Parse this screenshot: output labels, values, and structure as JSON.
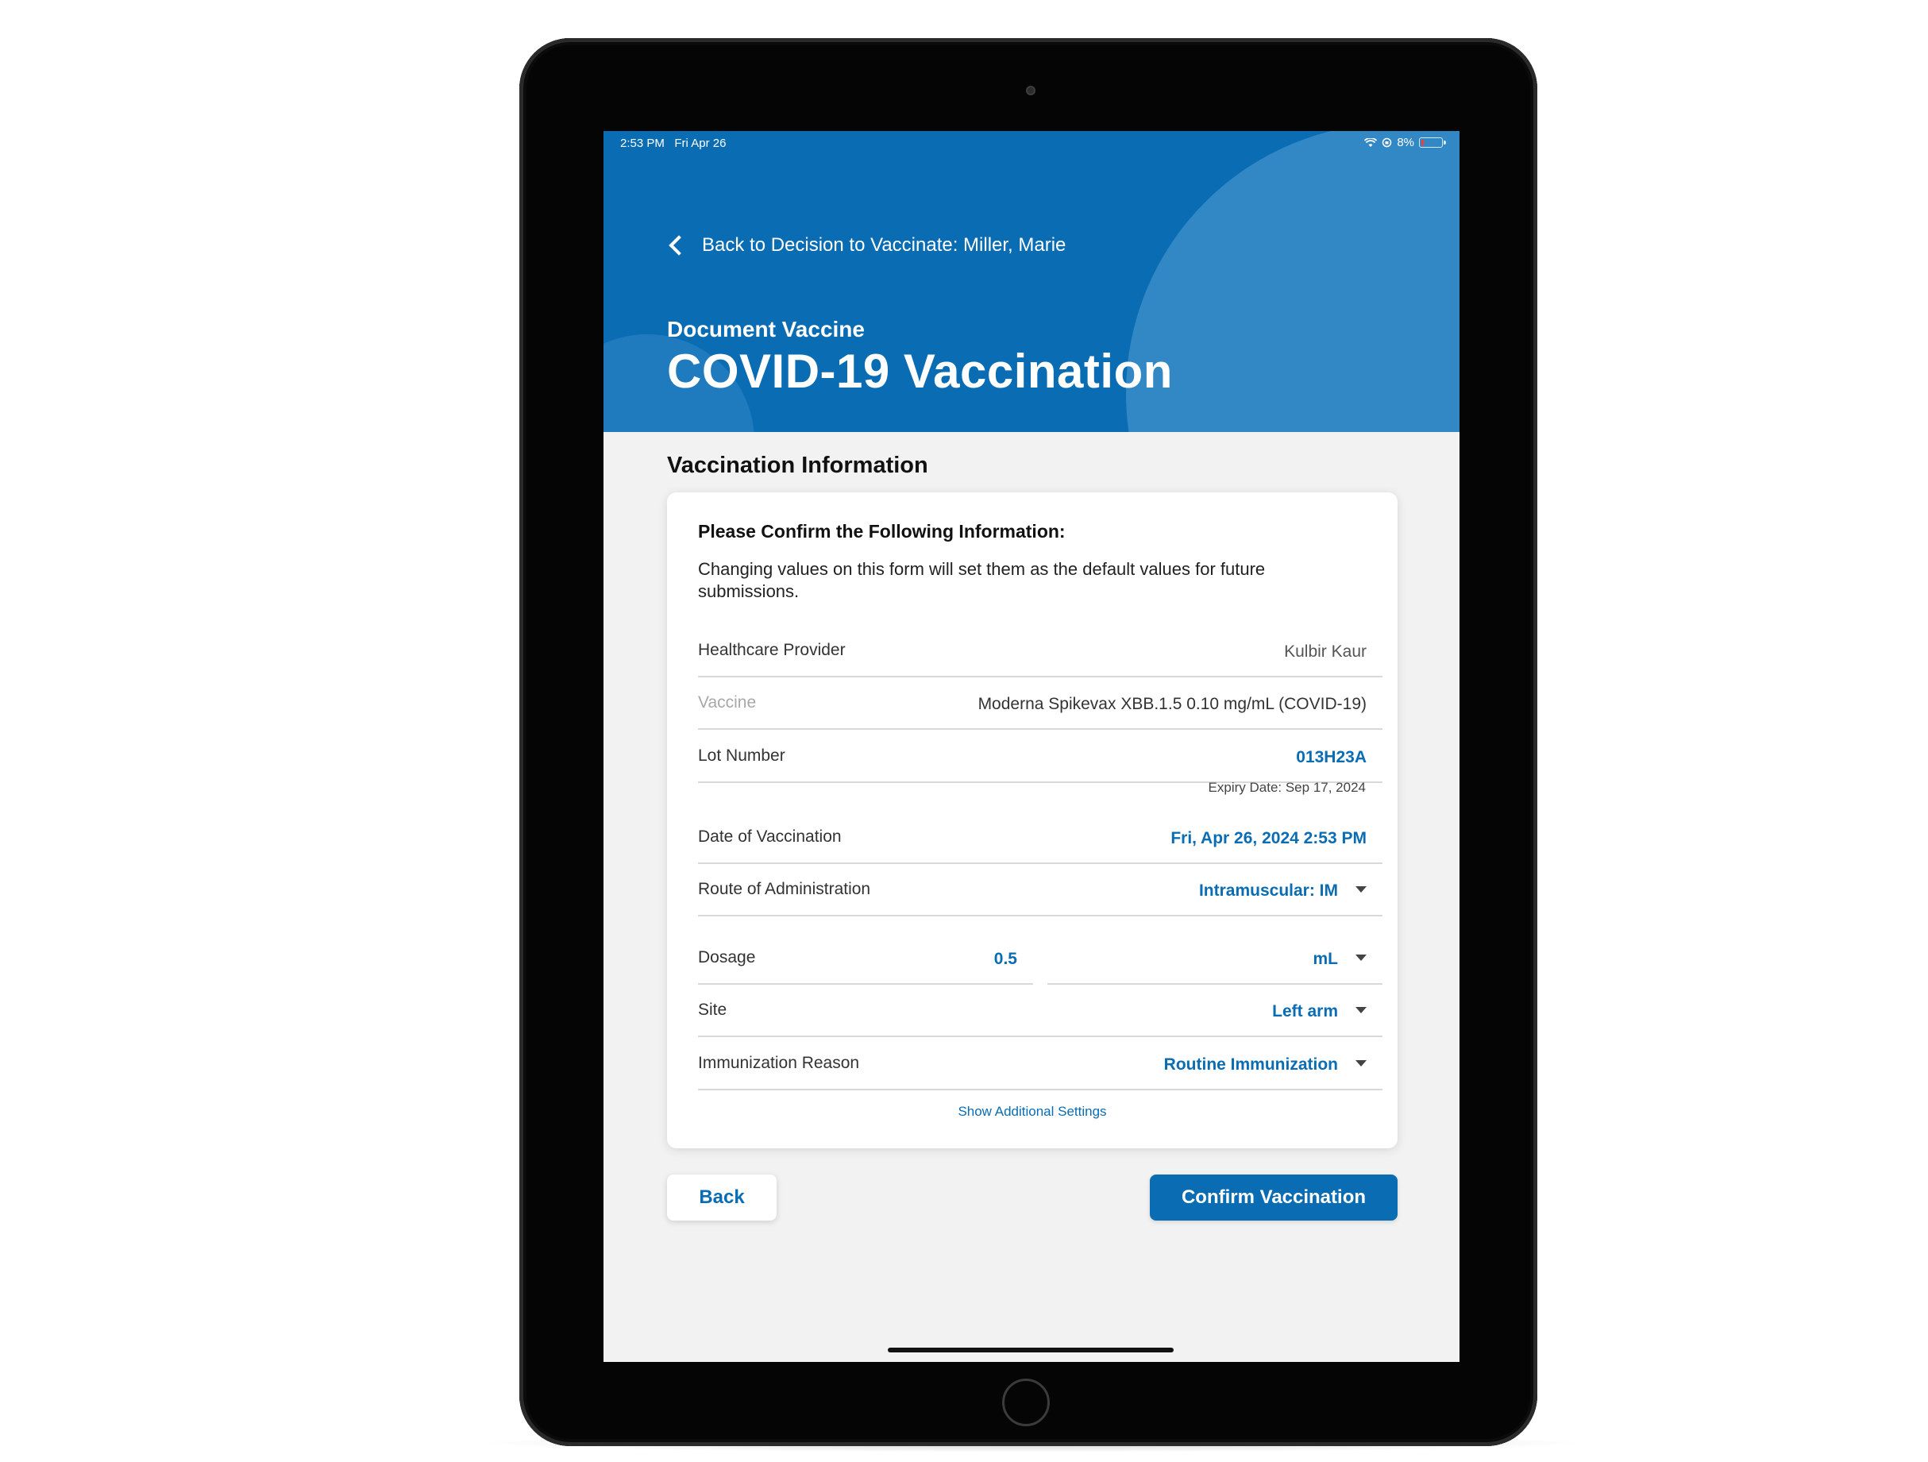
{
  "status_bar": {
    "time": "2:53 PM",
    "date": "Fri Apr 26",
    "battery": "8%"
  },
  "header": {
    "back_label": "Back to Decision to Vaccinate: Miller, Marie",
    "subtitle": "Document Vaccine",
    "title": "COVID-19 Vaccination"
  },
  "section_title": "Vaccination Information",
  "card": {
    "heading": "Please Confirm the Following Information:",
    "description": "Changing values on this form will set them as the default values for future submissions.",
    "fields": {
      "provider": {
        "label": "Healthcare Provider",
        "value": "Kulbir Kaur"
      },
      "vaccine": {
        "label": "Vaccine",
        "value": "Moderna Spikevax XBB.1.5 0.10 mg/mL (COVID-19)"
      },
      "lot": {
        "label": "Lot Number",
        "value": "013H23A",
        "expiry": "Expiry Date: Sep 17, 2024"
      },
      "date": {
        "label": "Date of Vaccination",
        "value": "Fri, Apr 26, 2024 2:53 PM"
      },
      "route": {
        "label": "Route of Administration",
        "value": "Intramuscular: IM"
      },
      "dosage": {
        "label": "Dosage",
        "amount": "0.5",
        "unit": "mL"
      },
      "site": {
        "label": "Site",
        "value": "Left arm"
      },
      "reason": {
        "label": "Immunization Reason",
        "value": "Routine Immunization"
      }
    },
    "show_more": "Show Additional Settings"
  },
  "buttons": {
    "back": "Back",
    "confirm": "Confirm Vaccination"
  },
  "colors": {
    "brand_blue": "#0a6db4",
    "header_circle": "#3a8cc8"
  }
}
